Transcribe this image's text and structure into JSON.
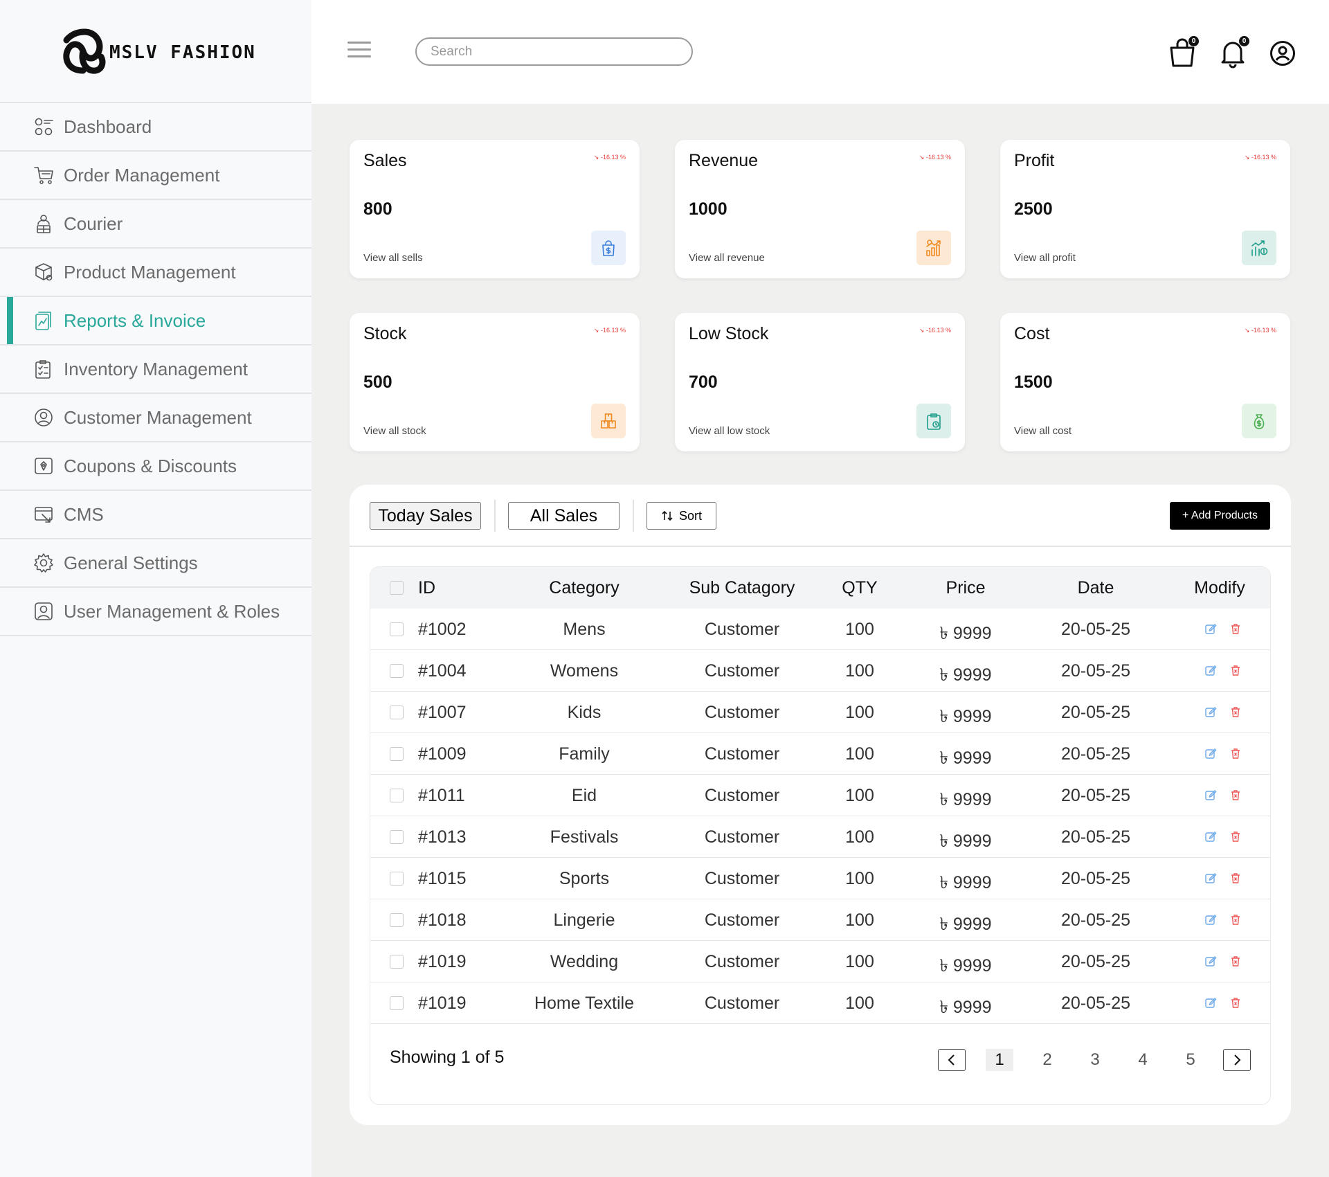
{
  "brand": {
    "name": "MSLV FASHION"
  },
  "sidebar": {
    "items": [
      {
        "label": "Dashboard",
        "icon": "dashboard-icon"
      },
      {
        "label": "Order Management",
        "icon": "cart-icon"
      },
      {
        "label": "Courier",
        "icon": "courier-icon"
      },
      {
        "label": "Product Management",
        "icon": "product-box-icon"
      },
      {
        "label": "Reports & Invoice",
        "icon": "report-icon",
        "active": true
      },
      {
        "label": "Inventory Management",
        "icon": "inventory-icon"
      },
      {
        "label": "Customer Management",
        "icon": "customer-icon"
      },
      {
        "label": "Coupons & Discounts",
        "icon": "coupon-icon"
      },
      {
        "label": "CMS",
        "icon": "cms-icon"
      },
      {
        "label": "General Settings",
        "icon": "gear-icon"
      },
      {
        "label": "User Management & Roles",
        "icon": "user-icon"
      }
    ]
  },
  "header": {
    "search_placeholder": "Search",
    "cart_count": "0",
    "notification_count": "0"
  },
  "stats": [
    {
      "title": "Sales",
      "value": "800",
      "link": "View all sells",
      "badge": "↘ -16.13 %",
      "icon": "shopping-bag-dollar-icon",
      "icon_bg": "#e8f0fb",
      "icon_color": "#3b7ddd"
    },
    {
      "title": "Revenue",
      "value": "1000",
      "link": "View all revenue",
      "badge": "↘ -16.13 %",
      "icon": "revenue-chart-icon",
      "icon_bg": "#fde8d4",
      "icon_color": "#ef8a1f"
    },
    {
      "title": "Profit",
      "value": "2500",
      "link": "View all profit",
      "badge": "↘ -16.13 %",
      "icon": "profit-chart-icon",
      "icon_bg": "#dcefeb",
      "icon_color": "#1f9d8a"
    },
    {
      "title": "Stock",
      "value": "500",
      "link": "View all stock",
      "badge": "↘ -16.13 %",
      "icon": "boxes-icon",
      "icon_bg": "#fde9d6",
      "icon_color": "#ef8a1f"
    },
    {
      "title": "Low Stock",
      "value": "700",
      "link": "View all low stock",
      "badge": "↘ -16.13 %",
      "icon": "clipboard-icon",
      "icon_bg": "#dcefeb",
      "icon_color": "#1f9d8a"
    },
    {
      "title": "Cost",
      "value": "1500",
      "link": "View all cost",
      "badge": "↘ -16.13 %",
      "icon": "money-bag-icon",
      "icon_bg": "#e3f3e6",
      "icon_color": "#4caf50"
    }
  ],
  "toolbar": {
    "today_sales": "Today Sales",
    "all_sales": "All Sales",
    "sort": "Sort",
    "add_products": "+ Add Products"
  },
  "table": {
    "headers": [
      "ID",
      "Category",
      "Sub Catagory",
      "QTY",
      "Price",
      "Date",
      "Modify"
    ],
    "rows": [
      {
        "id": "#1002",
        "category": "Mens",
        "sub": "Customer",
        "qty": "100",
        "price": "৳ 9999",
        "date": "20-05-25"
      },
      {
        "id": "#1004",
        "category": "Womens",
        "sub": "Customer",
        "qty": "100",
        "price": "৳ 9999",
        "date": "20-05-25"
      },
      {
        "id": "#1007",
        "category": "Kids",
        "sub": "Customer",
        "qty": "100",
        "price": "৳ 9999",
        "date": "20-05-25"
      },
      {
        "id": "#1009",
        "category": "Family",
        "sub": "Customer",
        "qty": "100",
        "price": "৳ 9999",
        "date": "20-05-25"
      },
      {
        "id": "#1011",
        "category": "Eid",
        "sub": "Customer",
        "qty": "100",
        "price": "৳ 9999",
        "date": "20-05-25"
      },
      {
        "id": "#1013",
        "category": "Festivals",
        "sub": "Customer",
        "qty": "100",
        "price": "৳ 9999",
        "date": "20-05-25"
      },
      {
        "id": "#1015",
        "category": "Sports",
        "sub": "Customer",
        "qty": "100",
        "price": "৳ 9999",
        "date": "20-05-25"
      },
      {
        "id": "#1018",
        "category": "Lingerie",
        "sub": "Customer",
        "qty": "100",
        "price": "৳ 9999",
        "date": "20-05-25"
      },
      {
        "id": "#1019",
        "category": "Wedding",
        "sub": "Customer",
        "qty": "100",
        "price": "৳ 9999",
        "date": "20-05-25"
      },
      {
        "id": "#1019",
        "category": "Home Textile",
        "sub": "Customer",
        "qty": "100",
        "price": "৳ 9999",
        "date": "20-05-25"
      }
    ],
    "footer": "Showing 1 of 5",
    "pages": [
      "1",
      "2",
      "3",
      "4",
      "5"
    ]
  }
}
